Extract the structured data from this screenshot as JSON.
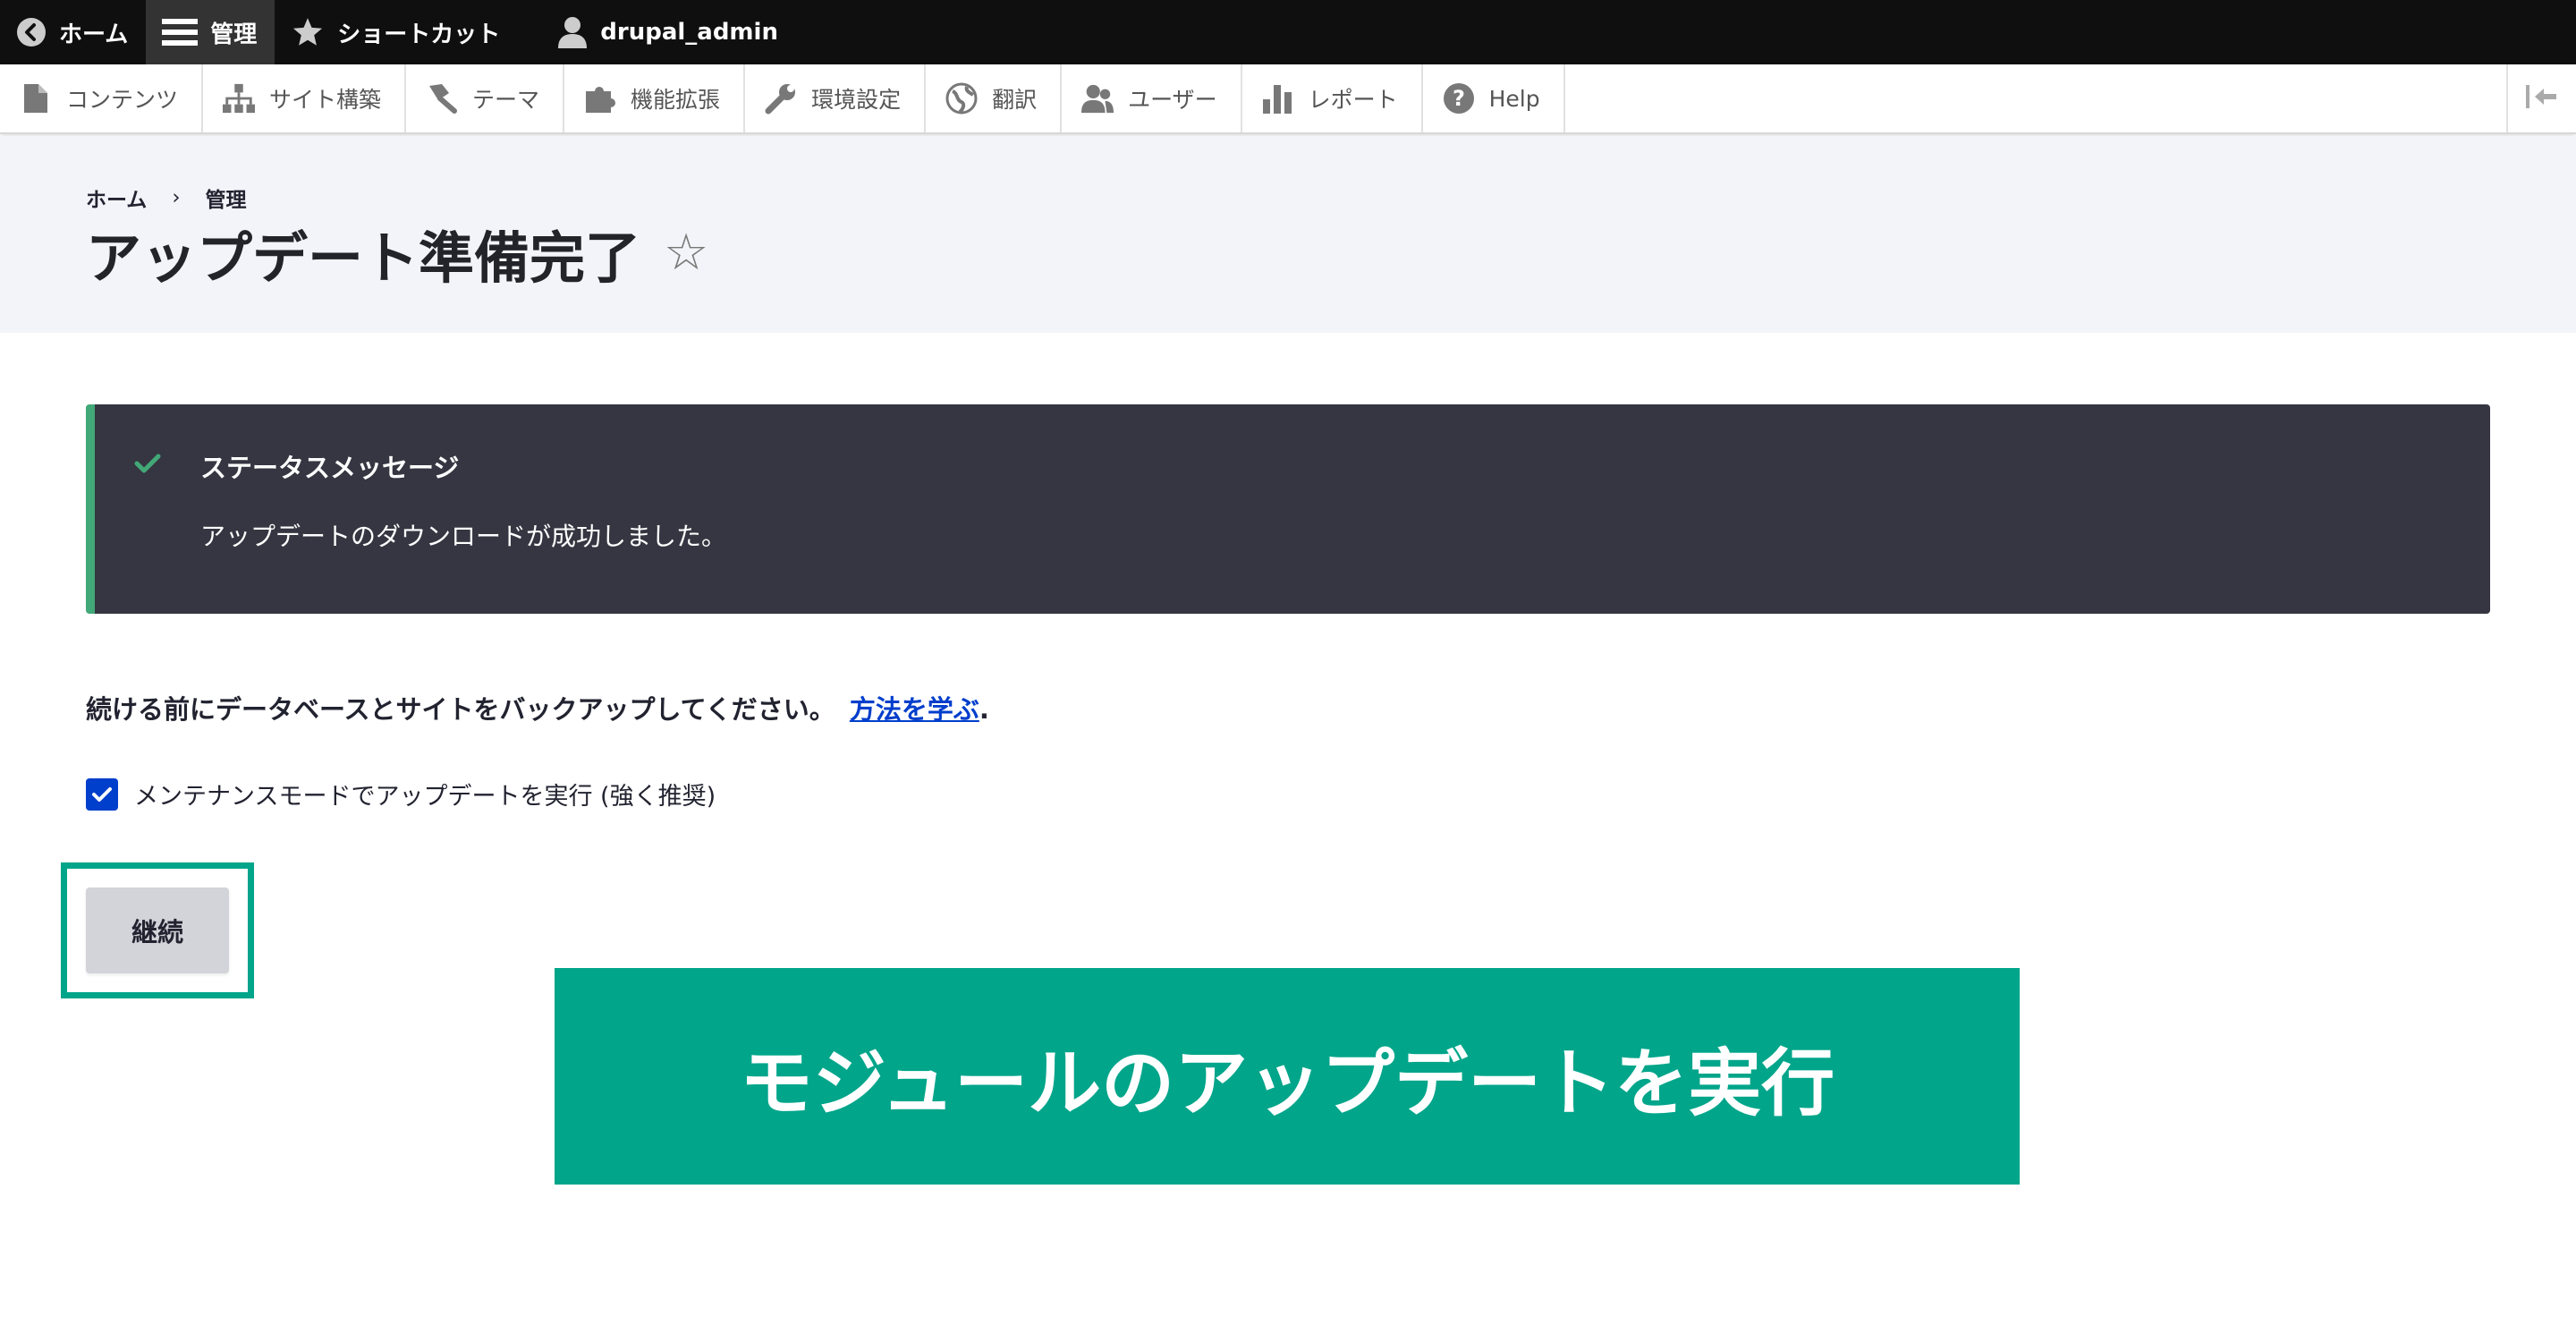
{
  "toolbar": {
    "items": [
      {
        "label": "ホーム",
        "icon": "back-arrow-icon"
      },
      {
        "label": "管理",
        "icon": "menu-icon",
        "active": true
      },
      {
        "label": "ショートカット",
        "icon": "star-icon"
      },
      {
        "label": "drupal_admin",
        "icon": "user-icon"
      }
    ]
  },
  "tray": {
    "items": [
      {
        "label": "コンテンツ",
        "icon": "document-icon"
      },
      {
        "label": "サイト構築",
        "icon": "structure-icon"
      },
      {
        "label": "テーマ",
        "icon": "paint-icon"
      },
      {
        "label": "機能拡張",
        "icon": "puzzle-icon"
      },
      {
        "label": "環境設定",
        "icon": "wrench-icon"
      },
      {
        "label": "翻訳",
        "icon": "globe-icon"
      },
      {
        "label": "ユーザー",
        "icon": "people-icon"
      },
      {
        "label": "レポート",
        "icon": "bar-chart-icon"
      },
      {
        "label": "Help",
        "icon": "help-icon"
      }
    ],
    "collapse_icon": "collapse-icon"
  },
  "breadcrumb": {
    "items": [
      "ホーム",
      "管理"
    ],
    "separator": "›"
  },
  "page": {
    "title": "アップデート準備完了",
    "star": "☆"
  },
  "status": {
    "title": "ステータスメッセージ",
    "message": "アップデートのダウンロードが成功しました。",
    "accent_color": "#42a877"
  },
  "backup": {
    "text": "続ける前にデータベースとサイトをバックアップしてください。",
    "link": "方法を学ぶ",
    "period": "."
  },
  "maintenance": {
    "label": "メンテナンスモードでアップデートを実行 (強く推奨)",
    "checked": true
  },
  "continue_button": {
    "label": "継続"
  },
  "banner": {
    "text": "モジュールのアップデートを実行",
    "color": "#00a58a"
  }
}
